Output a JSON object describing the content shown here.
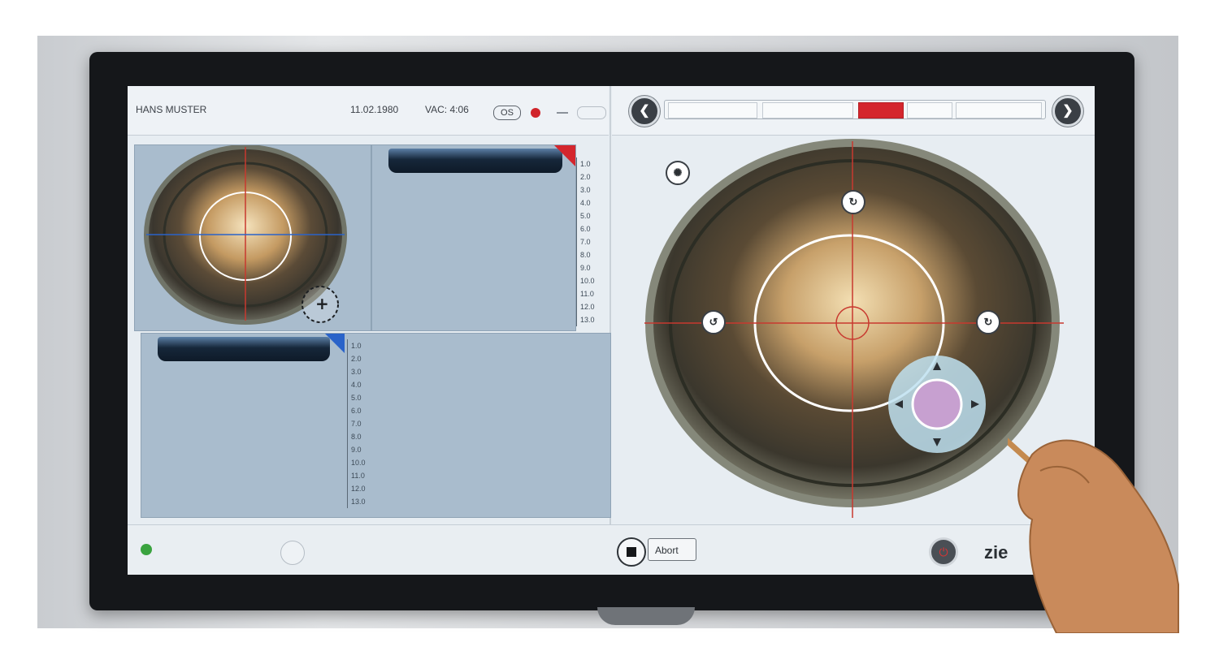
{
  "header": {
    "patient_name": "HANS MUSTER",
    "date": "11.02.1980",
    "vac": "VAC: 4:06",
    "eye": "OS"
  },
  "oct_scale_top": [
    "1.0",
    "2.0",
    "3.0",
    "4.0",
    "5.0",
    "6.0",
    "7.0",
    "8.0",
    "9.0",
    "10.0",
    "11.0",
    "12.0",
    "13.0"
  ],
  "oct_scale_bottom": [
    "1.0",
    "2.0",
    "3.0",
    "4.0",
    "5.0",
    "6.0",
    "7.0",
    "8.0",
    "9.0",
    "10.0",
    "11.0",
    "12.0",
    "13.0"
  ],
  "workflow_steps": [
    {
      "active": false
    },
    {
      "active": false
    },
    {
      "active": true
    },
    {
      "active": false
    }
  ],
  "footer": {
    "abort_label": "Abort",
    "brand_text": "zie"
  },
  "colors": {
    "accent_red": "#d4262d",
    "status_green": "#3aa33f",
    "panel_blue": "#a9bccd"
  },
  "icons": {
    "prev": "chevron-left-icon",
    "next": "chevron-right-icon",
    "stop": "stop-icon",
    "power": "power-icon",
    "illumination": "illumination-icon"
  }
}
